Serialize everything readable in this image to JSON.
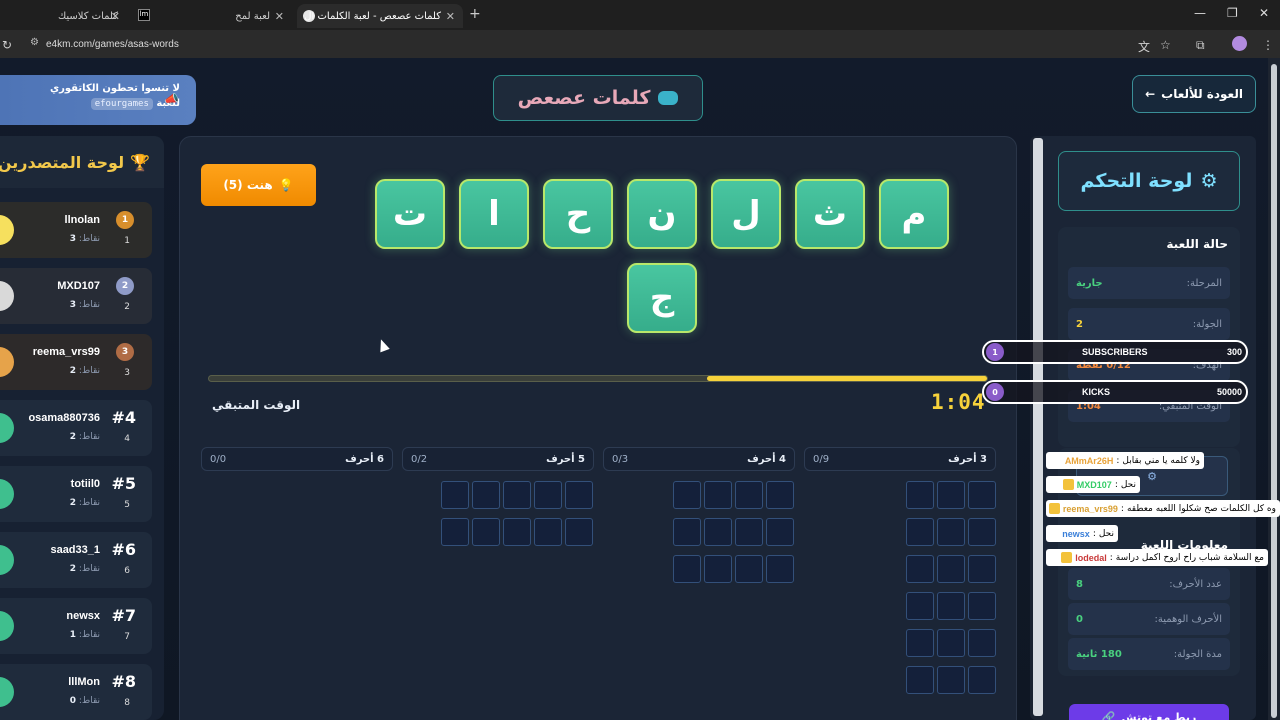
{
  "browser": {
    "tabs": [
      {
        "title": "كلمات كلاسيك",
        "active": false
      },
      {
        "title": "لعبة لمح",
        "active": false
      },
      {
        "title": "كلمات عصعص - لعبة الكلمات ال",
        "active": true
      }
    ],
    "new_tab": "+",
    "url": "e4km.com/games/asas-words",
    "window": {
      "minimize": "—",
      "restore": "❐",
      "close": "✕"
    }
  },
  "page": {
    "promo": {
      "line1": "لا تنسوا تحطون الكاتقوري",
      "line2": "للعبة",
      "tag": "efourgames"
    },
    "title": "كلمات عصعص",
    "back_label": "العودة للألعاب",
    "back_arrow": "←"
  },
  "leaderboard": {
    "title": "لوحة المتصدرين",
    "trophy_icon": "🏆",
    "points_label": "نقاط:",
    "players": [
      {
        "name": "llnolan",
        "points": "3",
        "rank": "1",
        "medal": "1",
        "avatar_color": "#f6e05e",
        "medal_color": "#d88f2c"
      },
      {
        "name": "MXD107",
        "points": "3",
        "rank": "2",
        "medal": "2",
        "avatar_color": "#d9d9d9",
        "medal_color": "#8f9bc8"
      },
      {
        "name": "reema_vrs99",
        "points": "2",
        "rank": "3",
        "medal": "3",
        "avatar_color": "#e6a34a",
        "medal_color": "#b06c45"
      },
      {
        "name": "osama880736",
        "points": "2",
        "rank": "4",
        "rank_label": "#4",
        "avatar_color": "#3fbf8e"
      },
      {
        "name": "totiil0",
        "points": "2",
        "rank": "5",
        "rank_label": "#5",
        "avatar_color": "#3fbf8e"
      },
      {
        "name": "saad33_1",
        "points": "2",
        "rank": "6",
        "rank_label": "#6",
        "avatar_color": "#3fbf8e"
      },
      {
        "name": "newsx",
        "points": "1",
        "rank": "7",
        "rank_label": "#7",
        "avatar_color": "#3fbf8e"
      },
      {
        "name": "lllMon",
        "points": "0",
        "rank": "8",
        "rank_label": "#8",
        "avatar_color": "#3fbf8e"
      }
    ]
  },
  "game": {
    "hint_label": "هنت (5)",
    "hint_icon": "💡",
    "letters_row1": [
      "م",
      "ث",
      "ل",
      "ن",
      "ح",
      "ا",
      "ت"
    ],
    "letters_row2": [
      "ج"
    ],
    "timer_label": "الوقت المتبقي",
    "timer_value": "1:04",
    "timer_fraction": 0.36,
    "columns": [
      {
        "label": "3 أحرف",
        "count": "0/9"
      },
      {
        "label": "4 أحرف",
        "count": "0/3"
      },
      {
        "label": "5 أحرف",
        "count": "0/2"
      },
      {
        "label": "6 أحرف",
        "count": "0/0"
      }
    ]
  },
  "control": {
    "title": "لوحة التحكم",
    "gear_icon": "⚙",
    "state_title": "حالة اللعبة",
    "rows": [
      {
        "key": "المرحلة:",
        "value": "جارية",
        "color": "#49d17f"
      },
      {
        "key": "الجولة:",
        "value": "2",
        "color": "#f7d23b"
      },
      {
        "key": "الهدف:",
        "value": "0/12 نقطة",
        "color": "#f0883e"
      },
      {
        "key": "الوقت المتبقي:",
        "value": "1:04",
        "color": "#f0883e"
      }
    ],
    "info_title": "معلومات اللعبة",
    "info_rows": [
      {
        "key": "عدد الأحرف:",
        "value": "8",
        "color": "#49d17f"
      },
      {
        "key": "الأحرف الوهمية:",
        "value": "0",
        "color": "#49d17f"
      },
      {
        "key": "مدة الجولة:",
        "value": "180 ثانية",
        "color": "#49d17f"
      }
    ],
    "stream_btn": "ربط مع توتش"
  },
  "overlay": {
    "goals": [
      {
        "badge": "1",
        "name": "SUBSCRIBERS",
        "count": "300"
      },
      {
        "badge": "0",
        "name": "KICKS",
        "count": "50000"
      }
    ],
    "chat": [
      {
        "user": "AMmAr26H",
        "text": "ولا كلمه يا مني بقابل",
        "color": "#e8a33a",
        "badge": false
      },
      {
        "user": "MXD107",
        "text": "نحل",
        "color": "#33cc66",
        "badge": true
      },
      {
        "user": "reema_vrs99",
        "text": "وه كل الكلمات صح شكلوا اللعبه معطقه",
        "color": "#d9a033",
        "badge": true
      },
      {
        "user": "newsx",
        "text": "نحل",
        "color": "#3a7fd9",
        "badge": false
      },
      {
        "user": "lodedal",
        "text": "مع السلامة شباب راح اروح اكمل دراسة",
        "color": "#c93a3a",
        "badge": true
      }
    ]
  }
}
